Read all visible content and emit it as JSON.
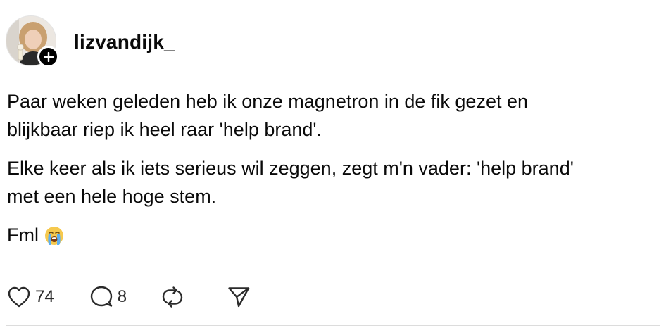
{
  "post": {
    "username": "lizvandijk_",
    "paragraphs": [
      "Paar weken geleden heb ik onze magnetron in de fik gezet en\nblijkbaar riep ik heel raar 'help brand'.",
      "Elke keer als ik iets serieus wil zeggen, zegt m'n vader: 'help brand'\nmet een hele hoge stem."
    ],
    "last_line": "Fml",
    "last_line_emoji": "loudly-crying-face"
  },
  "actions": {
    "likes": "74",
    "comments": "8",
    "like_icon": "heart-icon",
    "comment_icon": "comment-bubble-icon",
    "repost_icon": "repost-icon",
    "share_icon": "send-icon"
  },
  "colors": {
    "text": "#0a0a0a",
    "icon": "#2b2b2b",
    "badge": "#000000",
    "divider": "#dcdcdc"
  }
}
